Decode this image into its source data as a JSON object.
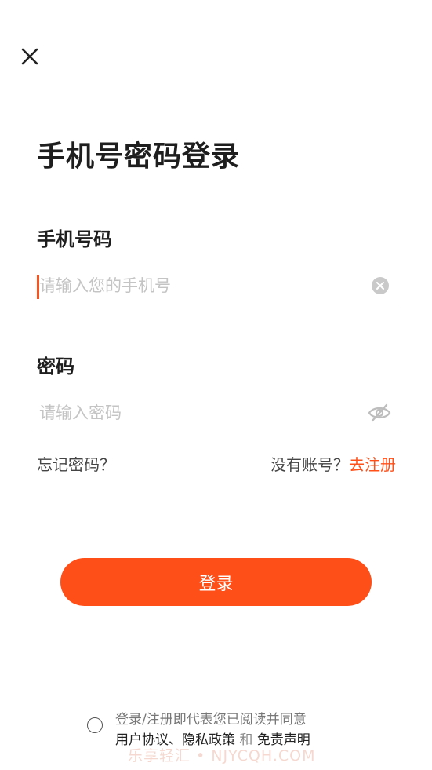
{
  "title": "手机号密码登录",
  "phone": {
    "label": "手机号码",
    "placeholder": "请输入您的手机号",
    "value": ""
  },
  "password": {
    "label": "密码",
    "placeholder": "请输入密码",
    "value": ""
  },
  "links": {
    "forgot": "忘记密码？",
    "no_account": "没有账号？",
    "register": "去注册"
  },
  "login_button": "登录",
  "agreement": {
    "line1": "登录/注册即代表您已阅读并同意",
    "user_agreement": "用户协议",
    "separator": "、",
    "privacy_policy": "隐私政策",
    "and": "和",
    "disclaimer": "免责声明"
  },
  "watermark": "乐享轻汇 • NJYCQH.COM",
  "colors": {
    "accent": "#ff4f19",
    "text": "#1e1e1e",
    "placeholder": "#c4c4c4",
    "divider": "#cfcfcf"
  },
  "icons": {
    "close": "close-icon",
    "clear": "clear-circle-icon",
    "password_visibility": "eye-off-icon"
  }
}
